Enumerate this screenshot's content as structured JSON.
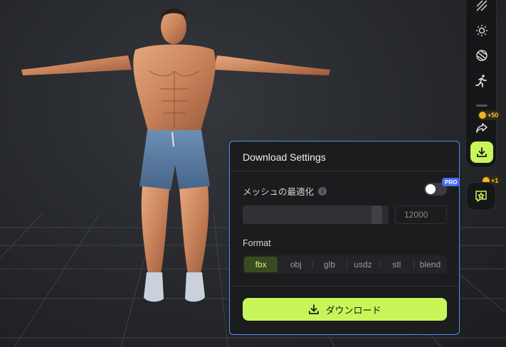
{
  "panel": {
    "title": "Download Settings",
    "mesh_optimize": {
      "label": "メッシュの最適化",
      "info_icon": "info-icon",
      "enabled": false,
      "badge": "PRO"
    },
    "polycount": {
      "value": "12000",
      "slider_fraction": 0.95
    },
    "format": {
      "label": "Format",
      "options": [
        "fbx",
        "obj",
        "glb",
        "usdz",
        "stl",
        "blend"
      ],
      "selected": "fbx"
    },
    "download_label": "ダウンロード"
  },
  "toolbar": {
    "icons": [
      "striped-pattern-icon",
      "sun-icon",
      "texture-icon",
      "running-person-icon",
      "share-icon",
      "download-icon"
    ],
    "share_badge": "+50",
    "favorite_badge": "+1"
  },
  "colors": {
    "accent": "#c8f65a",
    "panel_border": "#4d8ff0",
    "pro_badge": "#4b6cf0",
    "coin": "#f0b429"
  }
}
